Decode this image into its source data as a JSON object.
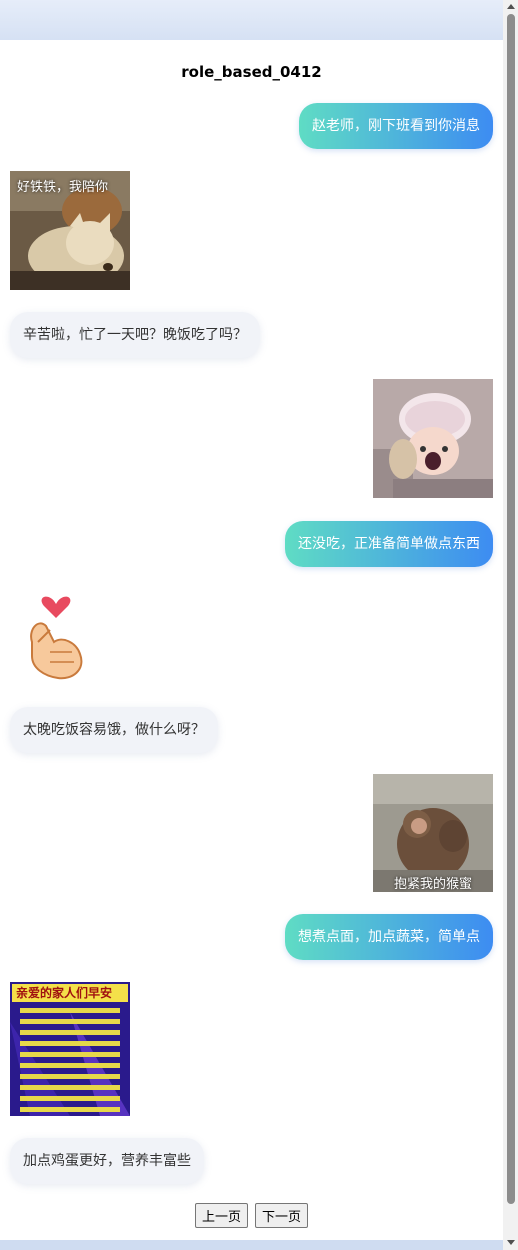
{
  "chat": {
    "title": "role_based_0412",
    "messages": [
      {
        "role": "user",
        "text": "赵老师，刚下班看到你消息"
      },
      {
        "role": "assistant",
        "sticker": "dogs-hugging-sticker",
        "caption": "好铁铁，我陪你"
      },
      {
        "role": "assistant",
        "text": "辛苦啦，忙了一天吧？晚饭吃了吗？"
      },
      {
        "role": "user",
        "sticker": "crying-baby-doll-sticker"
      },
      {
        "role": "user",
        "text": "还没吃，正准备简单做点东西"
      },
      {
        "role": "assistant",
        "sticker": "finger-heart-sticker"
      },
      {
        "role": "assistant",
        "text": "太晚吃饭容易饿，做什么呀？"
      },
      {
        "role": "user",
        "sticker": "monkeys-hugging-sticker",
        "caption": "抱紧我的猴蜜"
      },
      {
        "role": "user",
        "text": "想煮点面，加点蔬菜，简单点"
      },
      {
        "role": "assistant",
        "sticker": "good-morning-card-sticker",
        "card_title": "亲爱的家人们早安"
      },
      {
        "role": "assistant",
        "text": "加点鸡蛋更好，营养丰富些"
      }
    ]
  },
  "pager": {
    "prev_label": "上一页",
    "next_label": "下一页"
  },
  "colors": {
    "user_bubble_start": "#5fdcc4",
    "user_bubble_end": "#3d8cf2",
    "assistant_bubble": "#f1f3f8"
  }
}
